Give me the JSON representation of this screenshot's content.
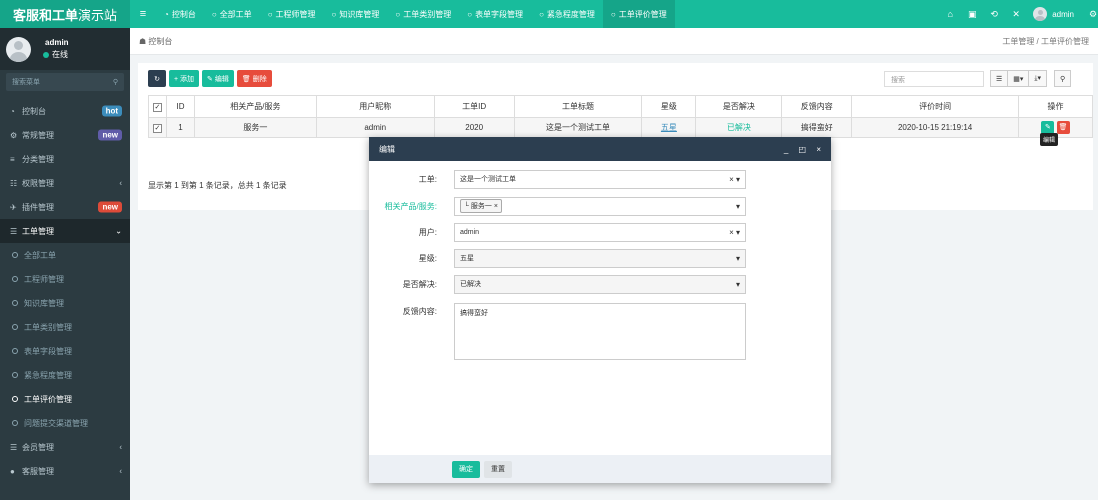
{
  "app": {
    "brand_bold": "客服和工单",
    "brand_rest": "演示站"
  },
  "topnav": {
    "tabs": [
      {
        "label": "控制台",
        "icon": "dashboard-icon"
      },
      {
        "label": "全部工单",
        "icon": "circle-icon"
      },
      {
        "label": "工程师管理",
        "icon": "circle-icon"
      },
      {
        "label": "知识库管理",
        "icon": "circle-icon"
      },
      {
        "label": "工单类别管理",
        "icon": "circle-icon"
      },
      {
        "label": "表单字段管理",
        "icon": "circle-icon"
      },
      {
        "label": "紧急程度管理",
        "icon": "circle-icon"
      },
      {
        "label": "工单评价管理",
        "icon": "circle-icon",
        "active": true
      }
    ],
    "username": "admin"
  },
  "sidebar": {
    "user_name": "admin",
    "user_status": "在线",
    "search_placeholder": "搜索菜单",
    "items": [
      {
        "label": "控制台",
        "badge": "hot",
        "badge_color": "#3c8dbc"
      },
      {
        "label": "常规管理",
        "badge": "new",
        "badge_color": "#605ca8"
      },
      {
        "label": "分类管理"
      },
      {
        "label": "权限管理",
        "arrow": "‹"
      },
      {
        "label": "插件管理",
        "badge": "new",
        "badge_color": "#dd4b39"
      },
      {
        "label": "工单管理",
        "arrow": "⌄"
      },
      {
        "label": "全部工单"
      },
      {
        "label": "工程师管理"
      },
      {
        "label": "知识库管理"
      },
      {
        "label": "工单类别管理"
      },
      {
        "label": "表单字段管理"
      },
      {
        "label": "紧急程度管理"
      },
      {
        "label": "工单评价管理"
      },
      {
        "label": "问题提交渠道管理"
      },
      {
        "label": "会员管理",
        "arrow": "‹"
      },
      {
        "label": "客服管理",
        "arrow": "‹"
      }
    ]
  },
  "breadcrumb": {
    "home": "控制台",
    "path": "工单管理 / 工单评价管理"
  },
  "toolbar": {
    "refresh_icon": "refresh-icon",
    "add_label": "+ 添加",
    "edit_label": "编辑",
    "delete_label": "删除",
    "search_placeholder": "搜索"
  },
  "table": {
    "headers": [
      "ID",
      "相关产品/服务",
      "用户昵称",
      "工单ID",
      "工单标题",
      "星级",
      "是否解决",
      "反馈内容",
      "评价时间",
      "操作"
    ],
    "rows": [
      {
        "id": "1",
        "product": "服务一",
        "user": "admin",
        "ticket_id": "2020",
        "title": "这是一个测试工单",
        "star": "五星",
        "resolved": "已解决",
        "feedback": "搞得蛮好",
        "time": "2020-10-15 21:19:14"
      }
    ],
    "tooltip": "编辑",
    "page_info": "显示第 1 到第 1 条记录，总共 1 条记录"
  },
  "modal": {
    "title": "编辑",
    "fields": {
      "ticket_label": "工单:",
      "ticket_value": "这是一个测试工单",
      "product_label": "相关产品/服务:",
      "product_tag": "└ 服务一 ×",
      "user_label": "用户:",
      "user_value": "admin",
      "star_label": "星级:",
      "star_value": "五星",
      "resolved_label": "是否解决:",
      "resolved_value": "已解决",
      "feedback_label": "反馈内容:",
      "feedback_value": "搞得蛮好"
    },
    "ok_label": "确定",
    "reset_label": "重置"
  },
  "colors": {
    "accent": "#18bc9c",
    "sidebar": "#2c3b41",
    "header": "#2c3e50",
    "danger": "#e74c3c"
  }
}
